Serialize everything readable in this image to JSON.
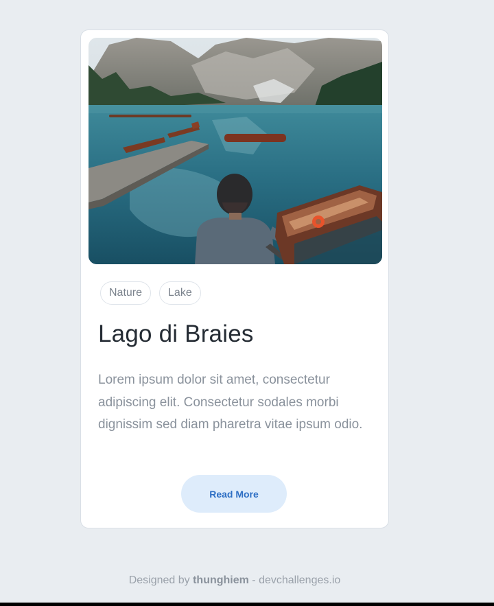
{
  "card": {
    "tags": [
      "Nature",
      "Lake"
    ],
    "title": "Lago di Braies",
    "description": "Lorem ipsum dolor sit amet, consectetur adipiscing elit. Consectetur sodales morbi dignissim sed diam pharetra vitae ipsum odio.",
    "button_label": "Read More"
  },
  "footer": {
    "prefix": "Designed by ",
    "author": "thunghiem",
    "suffix": " - devchallenges.io"
  },
  "colors": {
    "background": "#e9edf1",
    "card": "#ffffff",
    "button_bg": "#deecfb",
    "button_text": "#2e6fc4",
    "title": "#252c34"
  }
}
